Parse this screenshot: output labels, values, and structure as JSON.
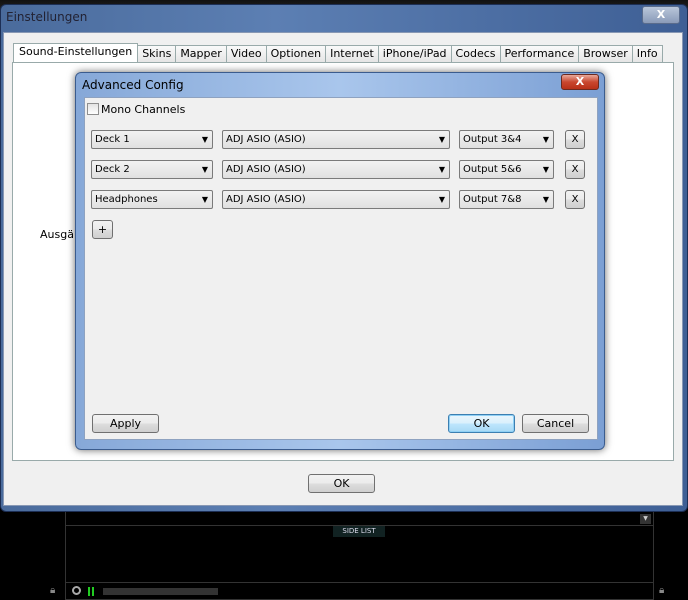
{
  "window": {
    "title": "Einstellungen",
    "close": "X"
  },
  "tabs": [
    "Sound-Einstellungen",
    "Skins",
    "Mapper",
    "Video",
    "Optionen",
    "Internet",
    "iPhone/iPad",
    "Codecs",
    "Performance",
    "Browser",
    "Info"
  ],
  "panel": {
    "partial_label": "Ausgän"
  },
  "ok_label": "OK",
  "dialog": {
    "title": "Advanced Config",
    "close": "X",
    "mono_label": "Mono Channels",
    "rows": [
      {
        "channel": "Deck 1",
        "device": "ADJ ASIO (ASIO)",
        "output": "Output 3&4",
        "remove": "X"
      },
      {
        "channel": "Deck 2",
        "device": "ADJ ASIO (ASIO)",
        "output": "Output 5&6",
        "remove": "X"
      },
      {
        "channel": "Headphones",
        "device": "ADJ ASIO (ASIO)",
        "output": "Output 7&8",
        "remove": "X"
      }
    ],
    "add": "+",
    "apply": "Apply",
    "ok": "OK",
    "cancel": "Cancel"
  },
  "app": {
    "side_list": "SIDE LIST"
  }
}
